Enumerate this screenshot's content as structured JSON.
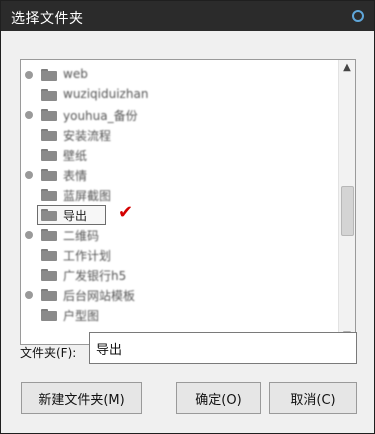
{
  "window": {
    "title": "选择文件夹"
  },
  "tree": {
    "items": [
      {
        "label": "web",
        "expander": true,
        "blur": true
      },
      {
        "label": "wuziqiduizhan",
        "expander": false,
        "blur": true
      },
      {
        "label": "youhua_备份",
        "expander": true,
        "blur": true
      },
      {
        "label": "安装流程",
        "expander": false,
        "blur": true
      },
      {
        "label": "壁纸",
        "expander": false,
        "blur": true
      },
      {
        "label": "表情",
        "expander": true,
        "blur": true
      },
      {
        "label": "蓝屏截图",
        "expander": false,
        "blur": true
      },
      {
        "label": "导出",
        "expander": false,
        "blur": false,
        "selected": true
      },
      {
        "label": "二维码",
        "expander": true,
        "blur": true
      },
      {
        "label": "工作计划",
        "expander": false,
        "blur": true
      },
      {
        "label": "广发银行h5",
        "expander": false,
        "blur": true
      },
      {
        "label": "后台网站模板",
        "expander": true,
        "blur": true
      },
      {
        "label": "户型图",
        "expander": false,
        "blur": true
      }
    ]
  },
  "folder_field": {
    "label": "文件夹(F):",
    "value": "导出"
  },
  "buttons": {
    "new_folder": "新建文件夹(M)",
    "ok": "确定(O)",
    "cancel": "取消(C)"
  },
  "icons": {
    "scroll_up": "scroll-up-arrow-icon",
    "scroll_down": "scroll-down-arrow-icon",
    "checkmark": "red-checkmark-icon"
  },
  "colors": {
    "titlebar": "#2b2b2b",
    "checkmark": "#d40000"
  }
}
